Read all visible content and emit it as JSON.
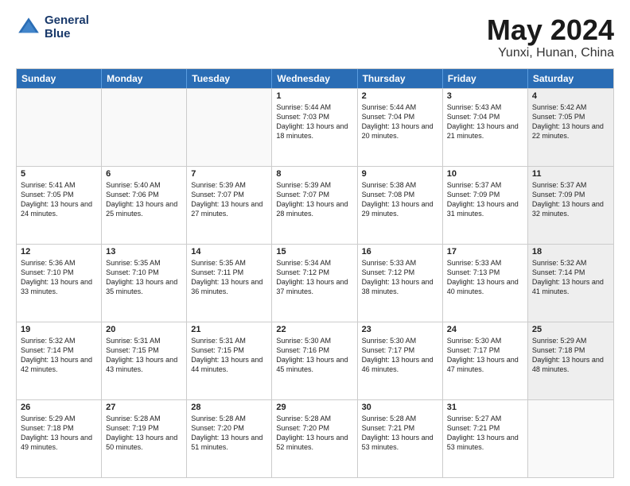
{
  "header": {
    "logo_line1": "General",
    "logo_line2": "Blue",
    "title": "May 2024",
    "location": "Yunxi, Hunan, China"
  },
  "days_of_week": [
    "Sunday",
    "Monday",
    "Tuesday",
    "Wednesday",
    "Thursday",
    "Friday",
    "Saturday"
  ],
  "weeks": [
    [
      {
        "day": "",
        "text": "",
        "empty": true
      },
      {
        "day": "",
        "text": "",
        "empty": true
      },
      {
        "day": "",
        "text": "",
        "empty": true
      },
      {
        "day": "1",
        "text": "Sunrise: 5:44 AM\nSunset: 7:03 PM\nDaylight: 13 hours and 18 minutes.",
        "empty": false,
        "shaded": false
      },
      {
        "day": "2",
        "text": "Sunrise: 5:44 AM\nSunset: 7:04 PM\nDaylight: 13 hours and 20 minutes.",
        "empty": false,
        "shaded": false
      },
      {
        "day": "3",
        "text": "Sunrise: 5:43 AM\nSunset: 7:04 PM\nDaylight: 13 hours and 21 minutes.",
        "empty": false,
        "shaded": false
      },
      {
        "day": "4",
        "text": "Sunrise: 5:42 AM\nSunset: 7:05 PM\nDaylight: 13 hours and 22 minutes.",
        "empty": false,
        "shaded": true
      }
    ],
    [
      {
        "day": "5",
        "text": "Sunrise: 5:41 AM\nSunset: 7:05 PM\nDaylight: 13 hours and 24 minutes.",
        "empty": false,
        "shaded": false
      },
      {
        "day": "6",
        "text": "Sunrise: 5:40 AM\nSunset: 7:06 PM\nDaylight: 13 hours and 25 minutes.",
        "empty": false,
        "shaded": false
      },
      {
        "day": "7",
        "text": "Sunrise: 5:39 AM\nSunset: 7:07 PM\nDaylight: 13 hours and 27 minutes.",
        "empty": false,
        "shaded": false
      },
      {
        "day": "8",
        "text": "Sunrise: 5:39 AM\nSunset: 7:07 PM\nDaylight: 13 hours and 28 minutes.",
        "empty": false,
        "shaded": false
      },
      {
        "day": "9",
        "text": "Sunrise: 5:38 AM\nSunset: 7:08 PM\nDaylight: 13 hours and 29 minutes.",
        "empty": false,
        "shaded": false
      },
      {
        "day": "10",
        "text": "Sunrise: 5:37 AM\nSunset: 7:09 PM\nDaylight: 13 hours and 31 minutes.",
        "empty": false,
        "shaded": false
      },
      {
        "day": "11",
        "text": "Sunrise: 5:37 AM\nSunset: 7:09 PM\nDaylight: 13 hours and 32 minutes.",
        "empty": false,
        "shaded": true
      }
    ],
    [
      {
        "day": "12",
        "text": "Sunrise: 5:36 AM\nSunset: 7:10 PM\nDaylight: 13 hours and 33 minutes.",
        "empty": false,
        "shaded": false
      },
      {
        "day": "13",
        "text": "Sunrise: 5:35 AM\nSunset: 7:10 PM\nDaylight: 13 hours and 35 minutes.",
        "empty": false,
        "shaded": false
      },
      {
        "day": "14",
        "text": "Sunrise: 5:35 AM\nSunset: 7:11 PM\nDaylight: 13 hours and 36 minutes.",
        "empty": false,
        "shaded": false
      },
      {
        "day": "15",
        "text": "Sunrise: 5:34 AM\nSunset: 7:12 PM\nDaylight: 13 hours and 37 minutes.",
        "empty": false,
        "shaded": false
      },
      {
        "day": "16",
        "text": "Sunrise: 5:33 AM\nSunset: 7:12 PM\nDaylight: 13 hours and 38 minutes.",
        "empty": false,
        "shaded": false
      },
      {
        "day": "17",
        "text": "Sunrise: 5:33 AM\nSunset: 7:13 PM\nDaylight: 13 hours and 40 minutes.",
        "empty": false,
        "shaded": false
      },
      {
        "day": "18",
        "text": "Sunrise: 5:32 AM\nSunset: 7:14 PM\nDaylight: 13 hours and 41 minutes.",
        "empty": false,
        "shaded": true
      }
    ],
    [
      {
        "day": "19",
        "text": "Sunrise: 5:32 AM\nSunset: 7:14 PM\nDaylight: 13 hours and 42 minutes.",
        "empty": false,
        "shaded": false
      },
      {
        "day": "20",
        "text": "Sunrise: 5:31 AM\nSunset: 7:15 PM\nDaylight: 13 hours and 43 minutes.",
        "empty": false,
        "shaded": false
      },
      {
        "day": "21",
        "text": "Sunrise: 5:31 AM\nSunset: 7:15 PM\nDaylight: 13 hours and 44 minutes.",
        "empty": false,
        "shaded": false
      },
      {
        "day": "22",
        "text": "Sunrise: 5:30 AM\nSunset: 7:16 PM\nDaylight: 13 hours and 45 minutes.",
        "empty": false,
        "shaded": false
      },
      {
        "day": "23",
        "text": "Sunrise: 5:30 AM\nSunset: 7:17 PM\nDaylight: 13 hours and 46 minutes.",
        "empty": false,
        "shaded": false
      },
      {
        "day": "24",
        "text": "Sunrise: 5:30 AM\nSunset: 7:17 PM\nDaylight: 13 hours and 47 minutes.",
        "empty": false,
        "shaded": false
      },
      {
        "day": "25",
        "text": "Sunrise: 5:29 AM\nSunset: 7:18 PM\nDaylight: 13 hours and 48 minutes.",
        "empty": false,
        "shaded": true
      }
    ],
    [
      {
        "day": "26",
        "text": "Sunrise: 5:29 AM\nSunset: 7:18 PM\nDaylight: 13 hours and 49 minutes.",
        "empty": false,
        "shaded": false
      },
      {
        "day": "27",
        "text": "Sunrise: 5:28 AM\nSunset: 7:19 PM\nDaylight: 13 hours and 50 minutes.",
        "empty": false,
        "shaded": false
      },
      {
        "day": "28",
        "text": "Sunrise: 5:28 AM\nSunset: 7:20 PM\nDaylight: 13 hours and 51 minutes.",
        "empty": false,
        "shaded": false
      },
      {
        "day": "29",
        "text": "Sunrise: 5:28 AM\nSunset: 7:20 PM\nDaylight: 13 hours and 52 minutes.",
        "empty": false,
        "shaded": false
      },
      {
        "day": "30",
        "text": "Sunrise: 5:28 AM\nSunset: 7:21 PM\nDaylight: 13 hours and 53 minutes.",
        "empty": false,
        "shaded": false
      },
      {
        "day": "31",
        "text": "Sunrise: 5:27 AM\nSunset: 7:21 PM\nDaylight: 13 hours and 53 minutes.",
        "empty": false,
        "shaded": false
      },
      {
        "day": "",
        "text": "",
        "empty": true,
        "shaded": true
      }
    ]
  ]
}
